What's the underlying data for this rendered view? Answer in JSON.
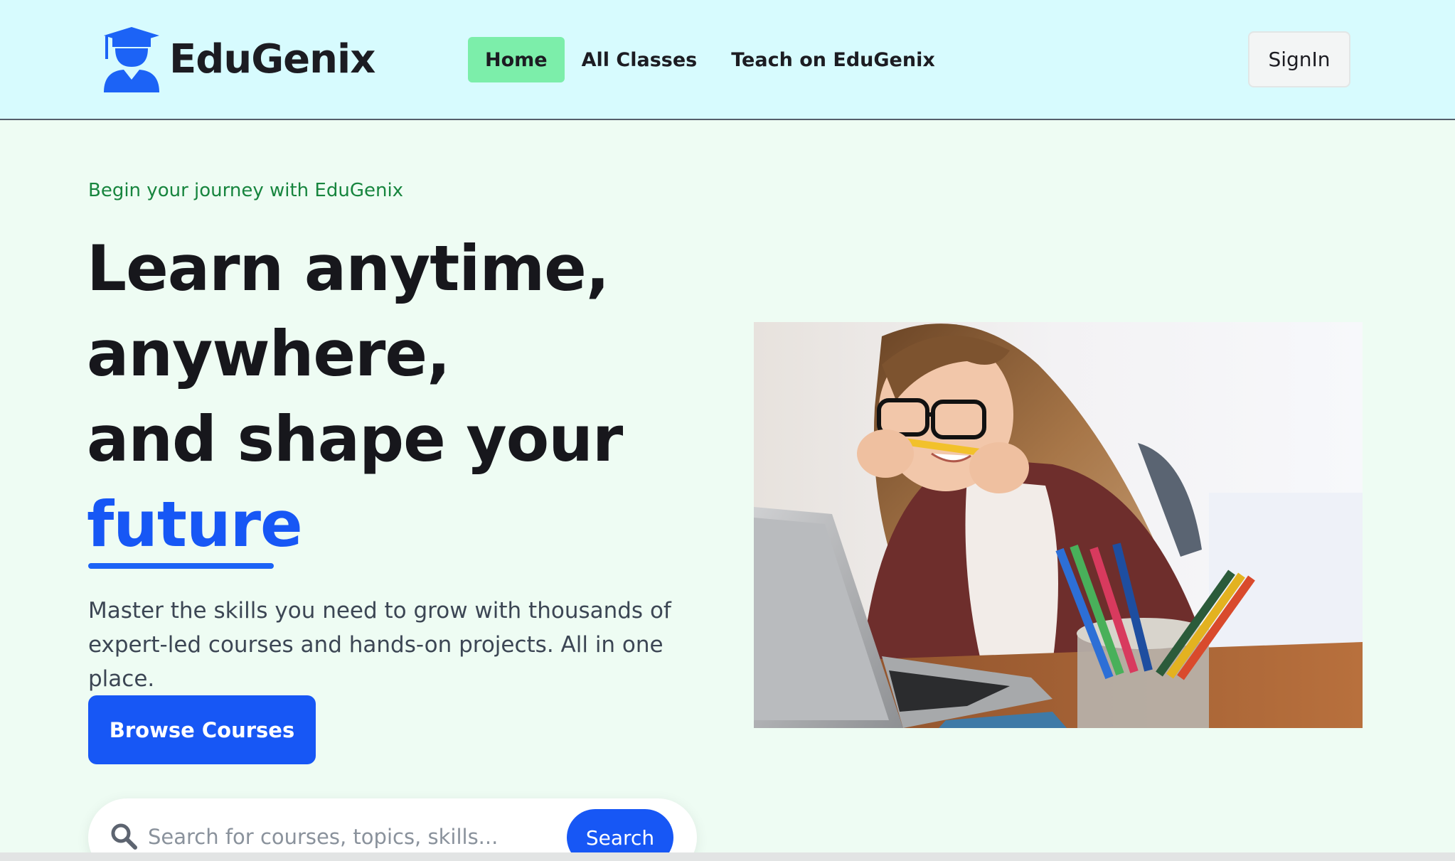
{
  "brand": {
    "name": "EduGenix",
    "logo_icon": "graduate-icon",
    "color": "#1c63f6"
  },
  "nav": {
    "items": [
      {
        "label": "Home",
        "active": true
      },
      {
        "label": "All Classes",
        "active": false
      },
      {
        "label": "Teach on EduGenix",
        "active": false
      }
    ],
    "signin_label": "SignIn"
  },
  "hero": {
    "tagline": "Begin your journey with EduGenix",
    "headline_lines": [
      "Learn anytime,",
      "anywhere,",
      "and shape your"
    ],
    "headline_accent": "future",
    "description": "Master the skills you need to grow with thousands of expert-led courses and hands-on projects. All in one place.",
    "cta_label": "Browse Courses",
    "image_icon": "student-with-laptop-photo"
  },
  "search": {
    "placeholder": "Search for courses, topics, skills...",
    "button_label": "Search",
    "icon": "search-icon"
  },
  "colors": {
    "nav_bg": "#d7fbfe",
    "page_bg": "#eefcf3",
    "active_nav": "#7ceeaa",
    "primary": "#1757f5",
    "tagline": "#17853e"
  }
}
